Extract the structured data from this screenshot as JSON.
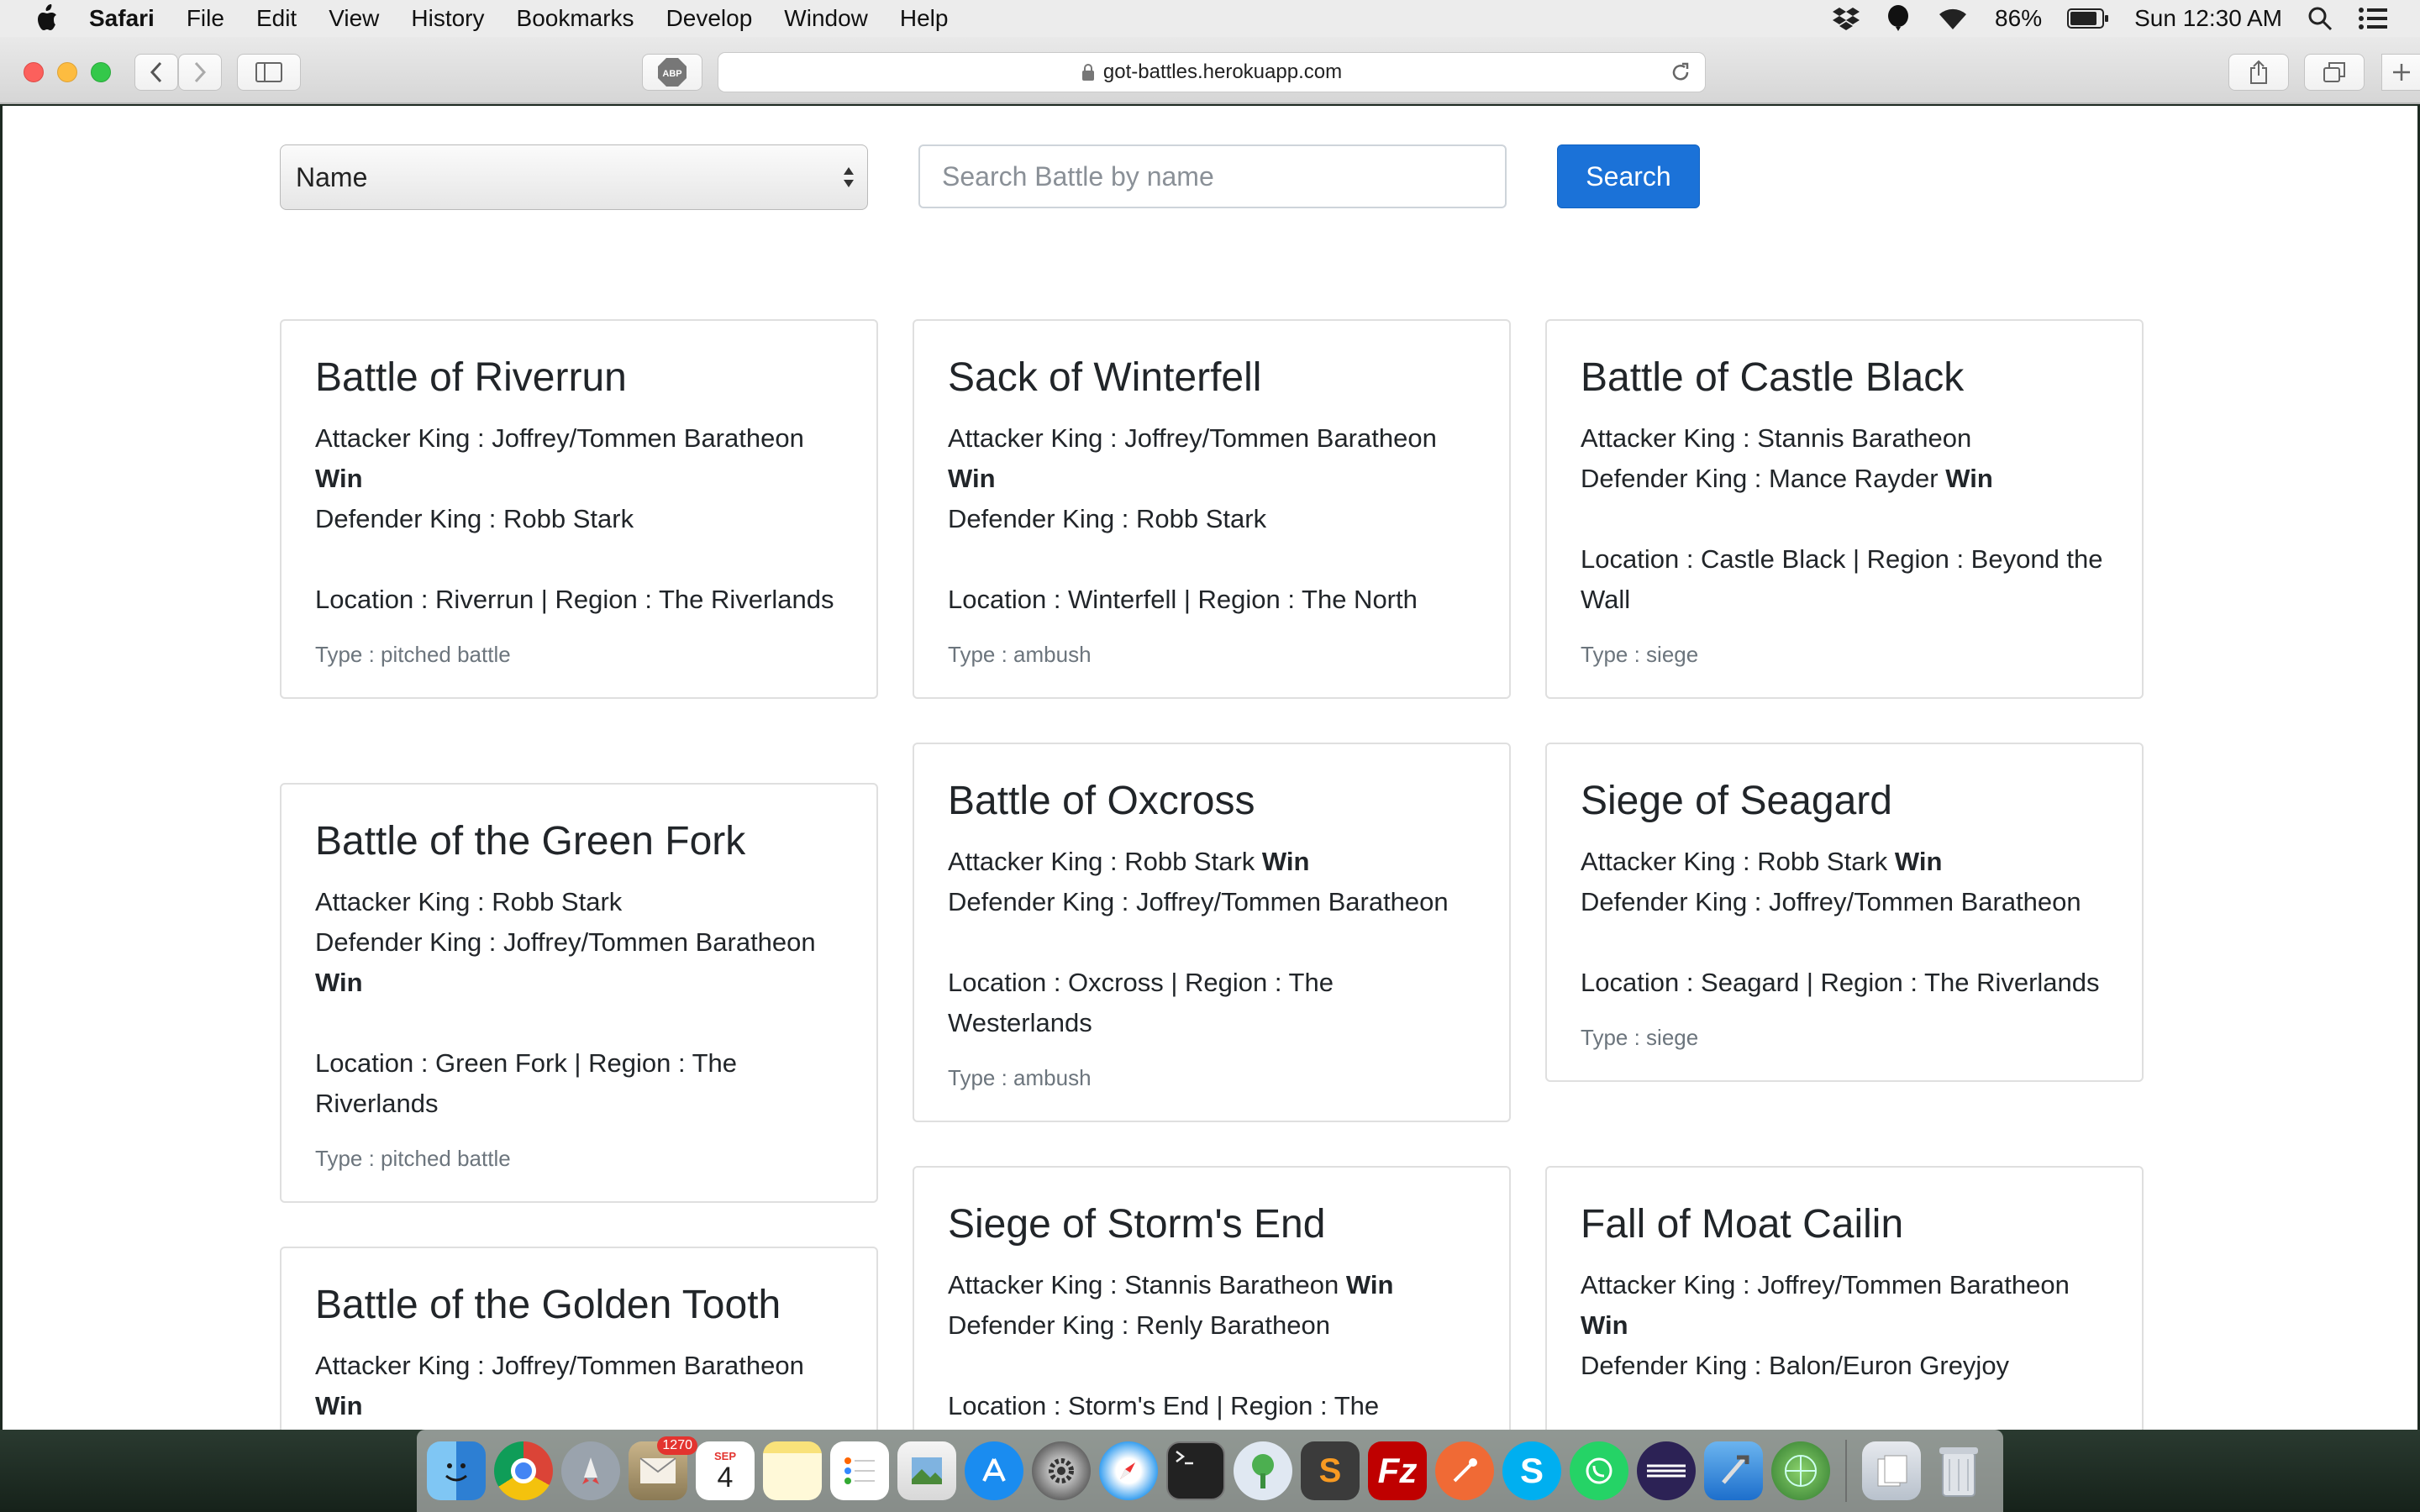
{
  "menubar": {
    "app_name": "Safari",
    "items": [
      "File",
      "Edit",
      "View",
      "History",
      "Bookmarks",
      "Develop",
      "Window",
      "Help"
    ],
    "battery": "86%",
    "clock": "Sun 12:30 AM"
  },
  "browser": {
    "url": "got-battles.herokuapp.com",
    "adblock_label": "ABP"
  },
  "filters": {
    "select_value": "Name",
    "search_placeholder": "Search Battle by name",
    "search_button": "Search"
  },
  "cards": [
    {
      "title": "Battle of Riverrun",
      "attacker": "Attacker King : Joffrey/Tommen Baratheon",
      "attacker_win": "Win",
      "defender": "Defender King : Robb Stark",
      "defender_win": "",
      "location": "Location : Riverrun | Region : The Riverlands",
      "type": "Type : pitched battle"
    },
    {
      "title": "Sack of Winterfell",
      "attacker": "Attacker King : Joffrey/Tommen Baratheon",
      "attacker_win": "Win",
      "defender": "Defender King : Robb Stark",
      "defender_win": "",
      "location": "Location : Winterfell | Region : The North",
      "type": "Type : ambush"
    },
    {
      "title": "Battle of Castle Black",
      "attacker": "Attacker King : Stannis Baratheon",
      "attacker_win": "",
      "defender": "Defender King : Mance Rayder",
      "defender_win": "Win",
      "location": "Location : Castle Black | Region : Beyond the Wall",
      "type": "Type : siege"
    },
    {
      "title": "Battle of the Green Fork",
      "attacker": "Attacker King : Robb Stark",
      "attacker_win": "",
      "defender": "Defender King : Joffrey/Tommen Baratheon",
      "defender_win": "Win",
      "location": "Location : Green Fork | Region : The Riverlands",
      "type": "Type : pitched battle"
    },
    {
      "title": "Battle of Oxcross",
      "attacker": "Attacker King : Robb Stark",
      "attacker_win": "Win",
      "defender": "Defender King : Joffrey/Tommen Baratheon",
      "defender_win": "",
      "location": "Location : Oxcross | Region : The Westerlands",
      "type": "Type : ambush"
    },
    {
      "title": "Siege of Seagard",
      "attacker": "Attacker King : Robb Stark",
      "attacker_win": "Win",
      "defender": "Defender King : Joffrey/Tommen Baratheon",
      "defender_win": "",
      "location": "Location : Seagard | Region : The Riverlands",
      "type": "Type : siege"
    },
    {
      "title": "Battle of the Golden Tooth",
      "attacker": "Attacker King : Joffrey/Tommen Baratheon",
      "attacker_win": "Win",
      "defender": "",
      "defender_win": "",
      "location": "",
      "type": ""
    },
    {
      "title": "Siege of Storm's End",
      "attacker": "Attacker King : Stannis Baratheon",
      "attacker_win": "Win",
      "defender": "Defender King : Renly Baratheon",
      "defender_win": "",
      "location": "Location : Storm's End | Region : The",
      "type": ""
    },
    {
      "title": "Fall of Moat Cailin",
      "attacker": "Attacker King : Joffrey/Tommen Baratheon",
      "attacker_win": "Win",
      "defender": "Defender King : Balon/Euron Greyjoy",
      "defender_win": "",
      "location": "",
      "type": ""
    }
  ],
  "dock": {
    "mail_badge": "1270",
    "calendar_month": "SEP",
    "calendar_day": "4",
    "icons": [
      "finder-icon",
      "chrome-icon",
      "launchpad-icon",
      "mail-icon",
      "calendar-icon",
      "notes-icon",
      "reminders-icon",
      "preview-icon",
      "app-store-icon",
      "system-preferences-icon",
      "safari-icon",
      "terminal-icon",
      "sourcetree-icon",
      "sublime-text-icon",
      "filezilla-icon",
      "postman-icon",
      "skype-icon",
      "whatsapp-icon",
      "eclipse-icon",
      "xcode-icon",
      "world-clock-icon",
      "documents-icon",
      "trash-icon"
    ],
    "colors": {
      "accent": "#1b72d8"
    }
  }
}
